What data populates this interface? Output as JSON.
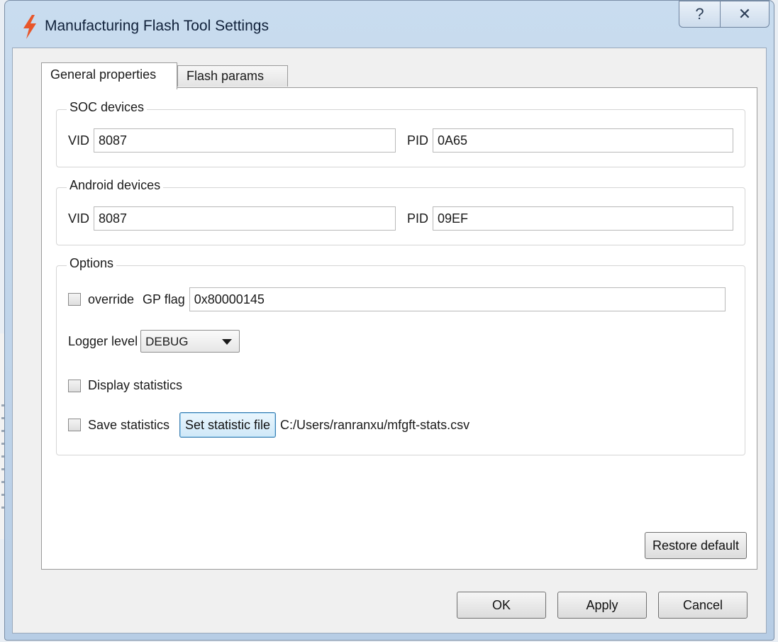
{
  "window": {
    "title": "Manufacturing Flash Tool Settings",
    "help_glyph": "?",
    "close_glyph": "✕"
  },
  "tabs": [
    {
      "label": "General properties",
      "active": true
    },
    {
      "label": "Flash params",
      "active": false
    }
  ],
  "soc": {
    "title": "SOC devices",
    "vid_label": "VID",
    "vid_value": "8087",
    "pid_label": "PID",
    "pid_value": "0A65"
  },
  "android": {
    "title": "Android devices",
    "vid_label": "VID",
    "vid_value": "8087",
    "pid_label": "PID",
    "pid_value": "09EF"
  },
  "options": {
    "title": "Options",
    "override_label": "override",
    "override_checked": false,
    "gp_flag_label": "GP flag",
    "gp_flag_value": "0x80000145",
    "logger_label": "Logger level",
    "logger_value": "DEBUG",
    "display_stats_label": "Display statistics",
    "display_stats_checked": false,
    "save_stats_label": "Save statistics",
    "save_stats_checked": false,
    "set_stat_file_label": "Set statistic file",
    "stat_file_path": "C:/Users/ranranxu/mfgft-stats.csv"
  },
  "restore_default_label": "Restore default",
  "footer": {
    "ok_label": "OK",
    "apply_label": "Apply",
    "cancel_label": "Cancel"
  },
  "colors": {
    "title_icon": "#e8562a",
    "focus_border": "#3c7fb1"
  }
}
